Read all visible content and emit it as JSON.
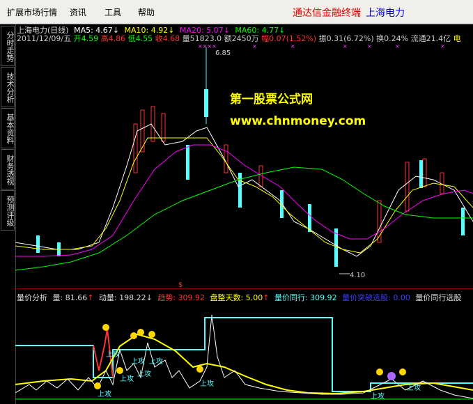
{
  "menu": {
    "items": [
      "扩展市场行情",
      "资讯",
      "工具",
      "帮助"
    ],
    "brand": "通达信金融终端",
    "stock": "上海电力"
  },
  "sidebar": {
    "tabs": [
      "分时走势",
      "技术分析",
      "基本资料",
      "财务透视",
      "预测评级"
    ]
  },
  "info": {
    "title": "上海电力(日线)",
    "ma5": "MA5: 4.67",
    "ma10": "MA10: 4.92",
    "ma20": "MA20: 5.07",
    "ma60": "MA60: 4.77",
    "date": "2011/12/09/五",
    "open": "开4.59",
    "high": "高4.86",
    "low": "低4.55",
    "close": "收4.68",
    "volume": "量51823.0",
    "amount": "额2450万",
    "change": "幅0.07(1.52%)",
    "amplitude": "振0.31(6.72%)",
    "turnover": "换0.24%",
    "float": "流通21.4亿",
    "sector": "电"
  },
  "chart": {
    "high_label": "6.85",
    "low_label": "4.10",
    "watermark_cn": "第一股票公式网",
    "watermark_url": "www.chnmoney.com"
  },
  "indicator": {
    "name": "量价分析",
    "vol": "量: 81.66",
    "momentum": "动量: 198.22",
    "trend": "趋势: 309.92",
    "consolidation": "盘整天数: 5.00",
    "sync": "量价同行: 309.92",
    "breakout": "量价突破选股: 0.00",
    "select": "量价同行选股",
    "attack": "上攻",
    "marker": "$"
  },
  "colors": {
    "up": "#ff3232",
    "down": "#54ffff",
    "ma5": "#ffffff",
    "ma10": "#ffff00",
    "ma20": "#ff00ff",
    "ma60": "#00ff00"
  }
}
